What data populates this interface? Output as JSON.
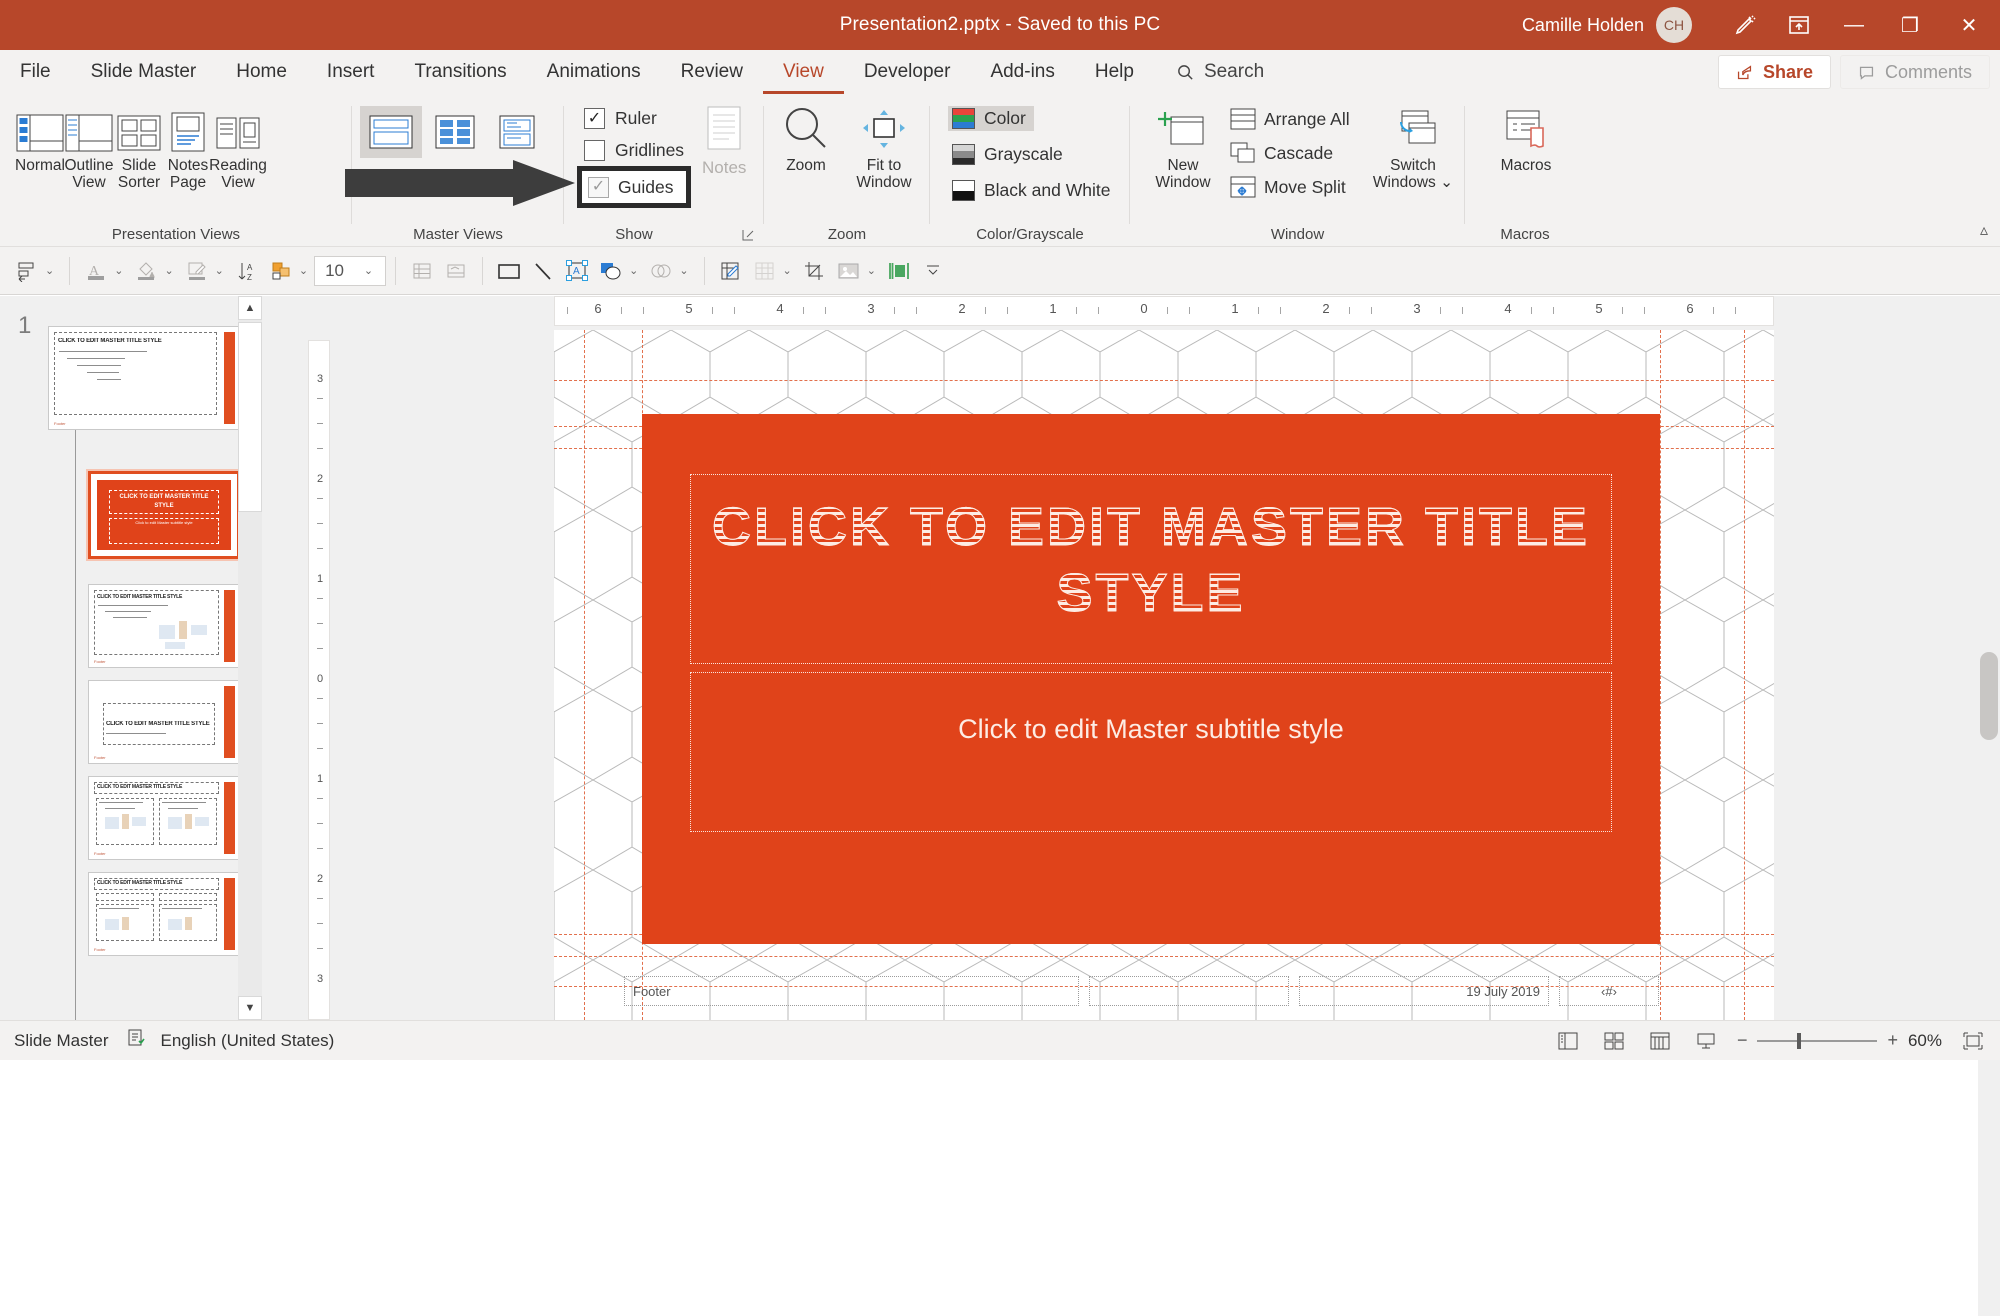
{
  "titlebar": {
    "filename": "Presentation2.pptx  -  Saved to this PC",
    "user_name": "Camille Holden",
    "avatar_initials": "CH",
    "ink_icon": "pen-ink-icon",
    "ribbon_display_icon": "ribbon-display-options-icon",
    "minimize": "—",
    "restore": "❐",
    "close": "✕",
    "bg_color": "#b7472a"
  },
  "tabs": {
    "items": [
      {
        "label": "File",
        "active": false
      },
      {
        "label": "Slide Master",
        "active": false
      },
      {
        "label": "Home",
        "active": false
      },
      {
        "label": "Insert",
        "active": false
      },
      {
        "label": "Transitions",
        "active": false
      },
      {
        "label": "Animations",
        "active": false
      },
      {
        "label": "Review",
        "active": false
      },
      {
        "label": "View",
        "active": true
      },
      {
        "label": "Developer",
        "active": false
      },
      {
        "label": "Add-ins",
        "active": false
      },
      {
        "label": "Help",
        "active": false
      }
    ],
    "search_label": "Search",
    "share_label": "Share",
    "comments_label": "Comments"
  },
  "ribbon": {
    "presentation_views": {
      "group_label": "Presentation Views",
      "buttons": [
        {
          "label": "Normal",
          "icon": "normal-view-icon"
        },
        {
          "label": "Outline View",
          "icon": "outline-view-icon"
        },
        {
          "label": "Slide Sorter",
          "icon": "slide-sorter-icon"
        },
        {
          "label": "Notes Page",
          "icon": "notes-page-icon"
        },
        {
          "label": "Reading View",
          "icon": "reading-view-icon"
        }
      ]
    },
    "master_views": {
      "group_label": "Master Views",
      "buttons": [
        {
          "name": "slide-master",
          "icon": "slide-master-icon",
          "selected": true
        },
        {
          "name": "handout-master",
          "icon": "handout-master-icon",
          "selected": false
        },
        {
          "name": "notes-master",
          "icon": "notes-master-icon",
          "selected": false
        }
      ]
    },
    "show": {
      "group_label": "Show",
      "checkboxes": [
        {
          "label": "Ruler",
          "checked": true,
          "greyed": false
        },
        {
          "label": "Gridlines",
          "checked": false,
          "greyed": false
        },
        {
          "label": "Guides",
          "checked": true,
          "greyed": true,
          "highlighted": true
        }
      ],
      "notes_label": "Notes",
      "notes_disabled": true,
      "dialog_launcher": "show-dialog-launcher"
    },
    "zoom": {
      "group_label": "Zoom",
      "zoom_label": "Zoom",
      "fit_label": "Fit to Window"
    },
    "color_grayscale": {
      "group_label": "Color/Grayscale",
      "options": [
        {
          "label": "Color",
          "selected": true
        },
        {
          "label": "Grayscale",
          "selected": false
        },
        {
          "label": "Black and White",
          "selected": false
        }
      ]
    },
    "window": {
      "group_label": "Window",
      "new_window_label": "New Window",
      "items": [
        {
          "label": "Arrange All",
          "icon": "arrange-all-icon"
        },
        {
          "label": "Cascade",
          "icon": "cascade-icon"
        },
        {
          "label": "Move Split",
          "icon": "move-split-icon"
        }
      ],
      "switch_windows_label": "Switch Windows"
    },
    "macros": {
      "group_label": "Macros",
      "label": "Macros"
    },
    "collapse_icon": "collapse-ribbon-icon"
  },
  "drawing_toolbar": {
    "font_size": "10",
    "icons": [
      "align-objects-icon",
      "font-color-icon",
      "shape-fill-icon",
      "shape-outline-pen-icon",
      "sort-icon",
      "arrange-objects-icon",
      "insert-table-icon",
      "insert-header-footer-icon",
      "rectangle-shape-icon",
      "line-shape-icon",
      "text-box-icon",
      "shapes-gallery-icon",
      "merge-shapes-icon",
      "edit-shape-icon",
      "table-grid-icon",
      "crop-icon",
      "picture-icon",
      "align-distribute-icon",
      "overflow-icon"
    ]
  },
  "thumbnails": {
    "slide_number": "1",
    "master_title": "CLICK TO EDIT MASTER TITLE STYLE",
    "layouts": [
      {
        "index": 1,
        "kind": "master",
        "selected": false,
        "title": "CLICK TO EDIT MASTER TITLE STYLE"
      },
      {
        "index": 2,
        "kind": "title-slide",
        "selected": true,
        "title": "CLICK TO EDIT MASTER TITLE STYLE",
        "sub": "Click to edit Master subtitle style"
      },
      {
        "index": 3,
        "kind": "title-content",
        "selected": false,
        "title": "CLICK TO EDIT MASTER TITLE STYLE"
      },
      {
        "index": 4,
        "kind": "section-header",
        "selected": false,
        "title": "CLICK TO EDIT MASTER TITLE STYLE"
      },
      {
        "index": 5,
        "kind": "two-content",
        "selected": false,
        "title": "CLICK TO EDIT MASTER TITLE STYLE"
      },
      {
        "index": 6,
        "kind": "comparison",
        "selected": false,
        "title": "CLICK TO EDIT MASTER TITLE STYLE"
      }
    ]
  },
  "rulers": {
    "horizontal": [
      "6",
      "5",
      "4",
      "3",
      "2",
      "1",
      "0",
      "1",
      "2",
      "3",
      "4",
      "5",
      "6"
    ],
    "vertical": [
      "3",
      "2",
      "1",
      "0",
      "1",
      "2",
      "3"
    ]
  },
  "slide": {
    "title": "CLICK TO EDIT MASTER TITLE STYLE",
    "subtitle": "Click to edit Master subtitle style",
    "bg_color": "#e0431a",
    "text_color": "#fdece4",
    "footer_left": "Footer",
    "footer_date": "19 July 2019",
    "footer_number": "‹#›"
  },
  "status": {
    "view_name": "Slide Master",
    "accessibility_icon": "accessibility-checker-icon",
    "language": "English (United States)",
    "view_buttons": [
      "normal-view-icon",
      "slide-sorter-icon",
      "reading-view-icon",
      "slideshow-icon"
    ],
    "zoom_out": "−",
    "zoom_in": "+",
    "zoom_level": "60%",
    "fit_slide_icon": "fit-slide-to-window-icon"
  }
}
